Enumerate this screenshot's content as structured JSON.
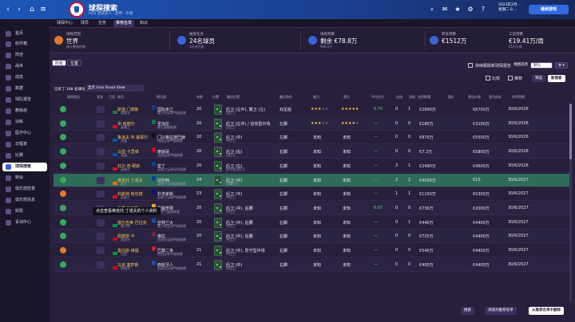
{
  "topbar": {
    "title": "球探搜索",
    "subtitle": "RCD 西班牙人 · 西甲 · 声望",
    "date_line1": "2023年2月…",
    "date_line2": "星期二 0…",
    "continue": "继续游戏",
    "icons": [
      "back-arrow-icon",
      "forward-arrow-icon",
      "home-icon",
      "menu-icon",
      "search-icon",
      "inbox-icon",
      "gear-icon",
      "help-icon"
    ]
  },
  "tabs": [
    "球探中心",
    "球员",
    "任务",
    "推荐名单",
    "知识"
  ],
  "sidebar": [
    {
      "label": "首页",
      "icon": "home-icon"
    },
    {
      "label": "收件箱",
      "icon": "inbox-icon"
    },
    {
      "label": "阵容",
      "icon": "squad-icon"
    },
    {
      "label": "战术",
      "icon": "tactics-icon"
    },
    {
      "label": "动态",
      "icon": "dynamics-icon"
    },
    {
      "label": "数据",
      "icon": "data-icon"
    },
    {
      "label": "球队报告",
      "icon": "report-icon"
    },
    {
      "label": "教练组",
      "icon": "staff-icon"
    },
    {
      "label": "训练",
      "icon": "training-icon"
    },
    {
      "label": "医疗中心",
      "icon": "medical-icon"
    },
    {
      "label": "日程表",
      "icon": "calendar-icon"
    },
    {
      "label": "比赛",
      "icon": "match-icon"
    },
    {
      "label": "球探搜索",
      "icon": "scouting-icon",
      "active": true
    },
    {
      "label": "转会",
      "icon": "transfer-icon"
    },
    {
      "label": "俱乐部愿景",
      "icon": "vision-icon"
    },
    {
      "label": "俱乐部信息",
      "icon": "club-info-icon"
    },
    {
      "label": "财政",
      "icon": "finance-icon"
    },
    {
      "label": "青训中心",
      "icon": "youth-icon"
    }
  ],
  "infobar": {
    "scope_title": "球探范围",
    "scope_value": "世界",
    "scope_sub": "统计整体前景",
    "tasks_title": "搜索任务",
    "tasks_value": "24名球员",
    "tasks_sub": "3名未完成",
    "budget_title": "球探预算",
    "budget_value": "剩余 €78.8万",
    "budget_sub": "€90.5万",
    "transfer_title": "转会预算",
    "transfer_value": "€1512万",
    "wage_title": "工资预算",
    "wage_value": "€19.41万/周",
    "wage_sub": "€16万/周"
  },
  "filters": {
    "chip_all": "所有",
    "chip_pos": "位置",
    "checkbox_label": "持续跟踪新球探报告",
    "view_label": "视图选项",
    "default_btn": "默认",
    "settings_btn": "⚙ ▾",
    "count_label": "已有了 108 名球员",
    "view_selector": "显示 Inno Scout View",
    "pill_compare": "比较",
    "pill_shortlist": "推荐",
    "pill_filter": "筛选",
    "pill_new": "新搜索"
  },
  "columns": [
    "球探报告",
    "状态",
    "已读",
    "球员",
    "俱乐部",
    "年龄",
    "位置",
    "最佳位置",
    "最佳角色",
    "能力",
    "潜力",
    "平均评分",
    "出场",
    "进球",
    "合同期满",
    "要价",
    "建议价格",
    "签约成本",
    "合同到期"
  ],
  "rows": [
    {
      "name": "斯诺·门德斯",
      "nat": "葡萄牙",
      "club": "国际米兰",
      "league": "意大利足球甲级联赛",
      "age": "20",
      "pos": "后卫 (左中), 翼卫 (左)",
      "role": "边后卫",
      "foot": "双足能",
      "abil": 3,
      "pot": 5,
      "rating": "6.70",
      "apps": "0",
      "goals": "1",
      "price": "€2890万",
      "value": "€6700万",
      "date": "30/6/2026",
      "hl": false,
      "flag": "#1e7a3a",
      "badge": "#1b3c8c",
      "scout": "g"
    },
    {
      "name": "米·哈德尔",
      "nat": "英格兰",
      "club": "圣加伦",
      "league": "瑞士超级联赛",
      "age": "20",
      "pos": "后卫 (左中) / 进攻型中场",
      "role": "边后卫",
      "foot": "左脚",
      "abil": 3,
      "pot": 4,
      "rating": "—",
      "apps": "0",
      "goals": "0",
      "price": "€180万",
      "value": "€3100万",
      "date": "30/6/2026",
      "hl": false,
      "flag": "#ce1124",
      "badge": "#0b7a3e",
      "scout": "g"
    },
    {
      "name": "鲁道夫·布·塞耶尔",
      "nat": "法国",
      "club": "门兴格拉德巴赫",
      "league": "德国足球甲级联赛",
      "age": "20",
      "pos": "后卫 (中)",
      "role": "中后卫",
      "foot": "左脚",
      "abil": 0,
      "pot": 0,
      "rating": "—",
      "apps": "0",
      "goals": "0",
      "price": "€870万",
      "value": "€5500万",
      "date": "30/6/2026",
      "hl": false,
      "flag": "#0055a4",
      "badge": "#111111",
      "scout": "g"
    },
    {
      "name": "马雷·卡里维",
      "nat": "法国",
      "club": "摩纳哥",
      "league": "法国足球甲级联赛",
      "age": "20",
      "pos": "后卫 (右)",
      "role": "边后卫",
      "foot": "右脚",
      "abil": 0,
      "pot": 0,
      "rating": "—",
      "apps": "0",
      "goals": "0",
      "price": "€7.2万",
      "value": "€5800万",
      "date": "30/6/2026",
      "hl": false,
      "flag": "#0055a4",
      "badge": "#e2001a",
      "scout": "g"
    },
    {
      "name": "杜尔·普·穆斯",
      "nat": "英格兰",
      "club": "雷丁",
      "league": "英格兰足球冠军联赛",
      "age": "20",
      "pos": "后卫 (右)",
      "role": "防守型边后卫",
      "foot": "右脚",
      "abil": 0,
      "pot": 0,
      "rating": "—",
      "apps": "3",
      "goals": "1",
      "price": "€2490万",
      "value": "€4600万",
      "date": "30/6/2026",
      "hl": false,
      "flag": "#ce1124",
      "badge": "#004494",
      "scout": "g"
    },
    {
      "name": "维克托·丁诺夫",
      "nat": "荷兰",
      "club": "切尔西",
      "league": "英格兰足球超级联赛",
      "age": "24",
      "pos": "后卫 (中)",
      "role": "边翼后卫",
      "foot": "右脚",
      "abil": 0,
      "pot": 0,
      "rating": "—",
      "apps": "2",
      "goals": "2",
      "price": "€4500万",
      "value": "€10",
      "date": "30/6/2027",
      "hl": true,
      "flag": "#ff6f00",
      "badge": "#034694",
      "scout": "g"
    },
    {
      "name": "科斯特·哈伍德",
      "nat": "英格兰",
      "club": "朴茨茅斯",
      "league": "英格兰足球甲级联赛",
      "age": "23",
      "pos": "后卫 (中)",
      "role": "中后卫",
      "foot": "右脚",
      "abil": 0,
      "pot": 0,
      "rating": "—",
      "apps": "1",
      "goals": "1",
      "price": "€1150万",
      "value": "€5300万",
      "date": "30/6/2027",
      "hl": false,
      "flag": "#ce1124",
      "badge": "#001489",
      "scout": "o"
    },
    {
      "name": "米基·哈丁斯",
      "nat": "法国",
      "club": "巴塞罗那",
      "league": "乌克兰超级联赛",
      "age": "20",
      "pos": "后卫 (中), 后腰",
      "role": "中后卫",
      "foot": "右脚",
      "abil": 0,
      "pot": 0,
      "rating": "6.67",
      "apps": "0",
      "goals": "0",
      "price": "€730万",
      "value": "€2000万",
      "date": "30/6/2027",
      "hl": false,
      "flag": "#0055a4",
      "badge": "#f5a623",
      "scout": "g"
    },
    {
      "name": "塞尔吉奥·巴拉克",
      "nat": "意大利",
      "club": "亚特兰大",
      "league": "意大利足球甲级联赛",
      "age": "20",
      "pos": "后卫 (中), 后腰",
      "role": "中后卫",
      "foot": "右脚",
      "abil": 0,
      "pot": 0,
      "rating": "—",
      "apps": "0",
      "goals": "1",
      "price": "€440万",
      "value": "€4400万",
      "date": "30/6/2027",
      "hl": false,
      "flag": "#009246",
      "badge": "#1e4aa0",
      "scout": "g"
    },
    {
      "name": "佩德罗·平",
      "nat": "西班牙",
      "club": "维拉",
      "league": "西班牙足球甲级联赛",
      "age": "20",
      "pos": "后卫 (中), 后腰",
      "role": "中后卫",
      "foot": "右脚",
      "abil": 0,
      "pot": 0,
      "rating": "—",
      "apps": "0",
      "goals": "0",
      "price": "€720万",
      "value": "€4400万",
      "date": "30/6/2027",
      "hl": false,
      "flag": "#c60b1e",
      "badge": "#7a1f3d",
      "scout": "g"
    },
    {
      "name": "桑托斯·维福",
      "nat": "巴西",
      "club": "巴黎二世",
      "league": "德国足球甲级联赛",
      "age": "21",
      "pos": "后卫 (中), 防守型中场",
      "role": "中后卫",
      "foot": "右脚",
      "abil": 0,
      "pot": 0,
      "rating": "—",
      "apps": "0",
      "goals": "0",
      "price": "€540万",
      "value": "€4400万",
      "date": "30/6/2027",
      "hl": false,
      "flag": "#009c3b",
      "badge": "#cf1b2b",
      "scout": "o"
    },
    {
      "name": "马克·塞萨斯",
      "nat": "西班牙",
      "club": "西班牙人",
      "league": "西班牙足球甲级联赛",
      "age": "21",
      "pos": "后卫 (中)",
      "role": "中后卫",
      "foot": "右脚",
      "abil": 0,
      "pot": 0,
      "rating": "—",
      "apps": "0",
      "goals": "0",
      "price": "€400万",
      "value": "€4400万",
      "date": "30/6/2027",
      "hl": false,
      "flag": "#c60b1e",
      "badge": "#1f4fa8",
      "scout": "g"
    }
  ],
  "misc": {
    "unknown": "未知",
    "tooltip": "点击查看维克托·丁诺夫的个人资料",
    "page_btn": "搜索",
    "add_btn": "添加为推荐名单",
    "remove_btn": "从推荐名单中删除"
  },
  "colors": {
    "sidebar_bg": "#1b1627",
    "topbar_blue": "#1d56b8",
    "row_highlight": "#2f6b59",
    "name_yellow": "#f3c64a",
    "star": "#f2c84b"
  }
}
